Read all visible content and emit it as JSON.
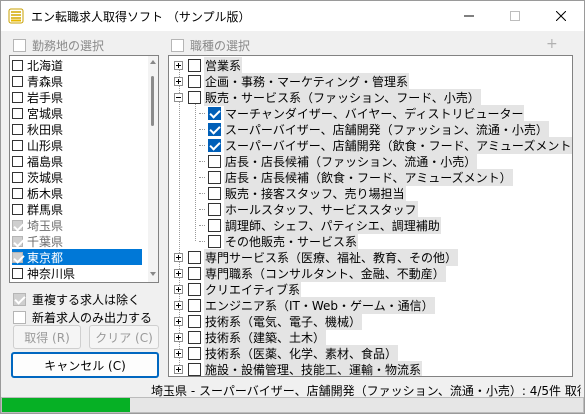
{
  "window": {
    "title": "エン転職求人取得ソフト （サンプル版）"
  },
  "left": {
    "header_label": "勤務地の選択",
    "prefectures": [
      {
        "label": "北海道",
        "checked": false,
        "grey": false,
        "selected": false
      },
      {
        "label": "青森県",
        "checked": false,
        "grey": false,
        "selected": false
      },
      {
        "label": "岩手県",
        "checked": false,
        "grey": false,
        "selected": false
      },
      {
        "label": "宮城県",
        "checked": false,
        "grey": false,
        "selected": false
      },
      {
        "label": "秋田県",
        "checked": false,
        "grey": false,
        "selected": false
      },
      {
        "label": "山形県",
        "checked": false,
        "grey": false,
        "selected": false
      },
      {
        "label": "福島県",
        "checked": false,
        "grey": false,
        "selected": false
      },
      {
        "label": "茨城県",
        "checked": false,
        "grey": false,
        "selected": false
      },
      {
        "label": "栃木県",
        "checked": false,
        "grey": false,
        "selected": false
      },
      {
        "label": "群馬県",
        "checked": false,
        "grey": false,
        "selected": false
      },
      {
        "label": "埼玉県",
        "checked": true,
        "grey": true,
        "selected": false
      },
      {
        "label": "千葉県",
        "checked": true,
        "grey": true,
        "selected": false
      },
      {
        "label": "東京都",
        "checked": true,
        "grey": true,
        "selected": true
      },
      {
        "label": "神奈川県",
        "checked": false,
        "grey": false,
        "selected": false
      }
    ],
    "option_dedupe": "重複する求人は除く",
    "option_new_only": "新着求人のみ出力する",
    "fetch_button": "取得 (R)",
    "clear_button": "クリア (C)",
    "cancel_button": "キャンセル (C)"
  },
  "right": {
    "header_label": "職種の選択",
    "plus_minus": "+ −",
    "tree": [
      {
        "label": "営業系",
        "level": 0,
        "expander": "plus",
        "checked": false,
        "highlight": true
      },
      {
        "label": "企画・事務・マーケティング・管理系",
        "level": 0,
        "expander": "plus",
        "checked": false,
        "highlight": true
      },
      {
        "label": "販売・サービス系（ファッション、フード、小売）",
        "level": 0,
        "expander": "minus",
        "checked": false,
        "highlight": true
      },
      {
        "label": "マーチャンダイザー、バイヤー、ディストリビューター",
        "level": 1,
        "expander": "",
        "checked": true,
        "highlight": true
      },
      {
        "label": "スーパーバイザー、店舗開発（ファッション、流通・小売）",
        "level": 1,
        "expander": "",
        "checked": true,
        "highlight": true
      },
      {
        "label": "スーパーバイザー、店舗開発（飲食・フード、アミューズメント）",
        "level": 1,
        "expander": "",
        "checked": true,
        "highlight": true
      },
      {
        "label": "店長・店長候補（ファッション、流通・小売）",
        "level": 1,
        "expander": "",
        "checked": false,
        "highlight": true
      },
      {
        "label": "店長・店長候補（飲食・フード、アミューズメント）",
        "level": 1,
        "expander": "",
        "checked": false,
        "highlight": true
      },
      {
        "label": "販売・接客スタッフ、売り場担当",
        "level": 1,
        "expander": "",
        "checked": false,
        "highlight": true
      },
      {
        "label": "ホールスタッフ、サービススタッフ",
        "level": 1,
        "expander": "",
        "checked": false,
        "highlight": true
      },
      {
        "label": "調理師、シェフ、パティシエ、調理補助",
        "level": 1,
        "expander": "",
        "checked": false,
        "highlight": true
      },
      {
        "label": "その他販売・サービス系",
        "level": 1,
        "expander": "",
        "checked": false,
        "highlight": true
      },
      {
        "label": "専門サービス系（医療、福祉、教育、その他）",
        "level": 0,
        "expander": "plus",
        "checked": false,
        "highlight": true
      },
      {
        "label": "専門職系（コンサルタント、金融、不動産）",
        "level": 0,
        "expander": "plus",
        "checked": false,
        "highlight": true
      },
      {
        "label": "クリエイティブ系",
        "level": 0,
        "expander": "plus",
        "checked": false,
        "highlight": true
      },
      {
        "label": "エンジニア系（IT・Web・ゲーム・通信）",
        "level": 0,
        "expander": "plus",
        "checked": false,
        "highlight": true
      },
      {
        "label": "技術系（電気、電子、機械）",
        "level": 0,
        "expander": "plus",
        "checked": false,
        "highlight": true
      },
      {
        "label": "技術系（建築、土木）",
        "level": 0,
        "expander": "plus",
        "checked": false,
        "highlight": true
      },
      {
        "label": "技術系（医薬、化学、素材、食品）",
        "level": 0,
        "expander": "plus",
        "checked": false,
        "highlight": true
      },
      {
        "label": "施設・設備管理、技能工、運輸・物流系",
        "level": 0,
        "expander": "plus",
        "checked": false,
        "highlight": true
      }
    ]
  },
  "status": {
    "text": "埼玉県 - スーパーバイザー、店舗開発（ファッション、流通・小売）: 4/5件 取得中...",
    "progress_fraction": 0.22,
    "progress_color": "#06b025"
  },
  "colors": {
    "accent": "#0078d7",
    "check_blue": "#005fb8"
  },
  "icons": {
    "app": "app-icon",
    "minimize": "minimize-icon",
    "maximize": "maximize-icon",
    "close": "close-icon"
  }
}
